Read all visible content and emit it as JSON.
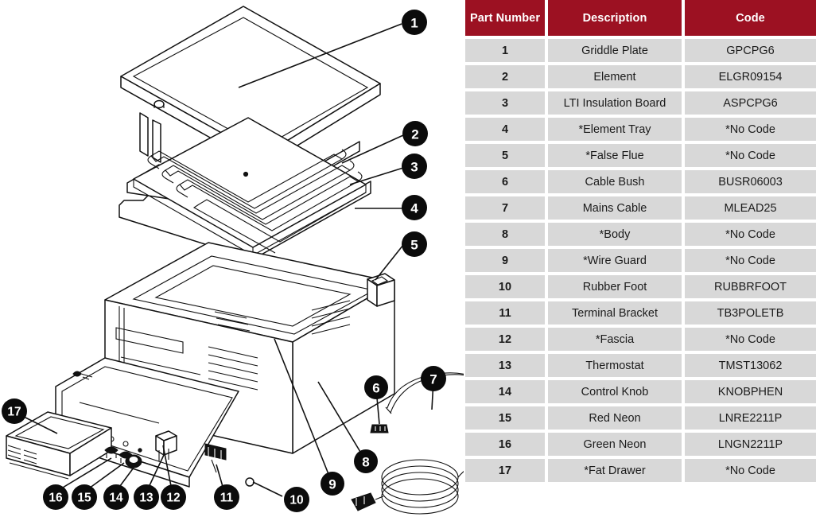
{
  "table": {
    "headers": [
      "Part Number",
      "Description",
      "Code"
    ],
    "header_bg": "#9c1122",
    "row_bg": "#d8d8d8",
    "rows": [
      {
        "number": "1",
        "description": "Griddle Plate",
        "code": "GPCPG6"
      },
      {
        "number": "2",
        "description": "Element",
        "code": "ELGR09154"
      },
      {
        "number": "3",
        "description": "LTI Insulation Board",
        "code": "ASPCPG6"
      },
      {
        "number": "4",
        "description": "*Element Tray",
        "code": "*No Code"
      },
      {
        "number": "5",
        "description": "*False Flue",
        "code": "*No Code"
      },
      {
        "number": "6",
        "description": "Cable Bush",
        "code": "BUSR06003"
      },
      {
        "number": "7",
        "description": "Mains Cable",
        "code": "MLEAD25"
      },
      {
        "number": "8",
        "description": "*Body",
        "code": "*No Code"
      },
      {
        "number": "9",
        "description": "*Wire Guard",
        "code": "*No Code"
      },
      {
        "number": "10",
        "description": "Rubber Foot",
        "code": "RUBBRFOOT"
      },
      {
        "number": "11",
        "description": "Terminal Bracket",
        "code": "TB3POLETB"
      },
      {
        "number": "12",
        "description": "*Fascia",
        "code": "*No Code"
      },
      {
        "number": "13",
        "description": "Thermostat",
        "code": "TMST13062"
      },
      {
        "number": "14",
        "description": "Control Knob",
        "code": "KNOBPHEN"
      },
      {
        "number": "15",
        "description": "Red Neon",
        "code": "LNRE2211P"
      },
      {
        "number": "16",
        "description": "Green Neon",
        "code": "LNGN2211P"
      },
      {
        "number": "17",
        "description": "*Fat Drawer",
        "code": "*No Code"
      }
    ]
  },
  "diagram": {
    "callouts": [
      {
        "id": "1",
        "label": "1",
        "part": "griddle-plate"
      },
      {
        "id": "2",
        "label": "2",
        "part": "element"
      },
      {
        "id": "3",
        "label": "3",
        "part": "lti-insulation-board"
      },
      {
        "id": "4",
        "label": "4",
        "part": "element-tray"
      },
      {
        "id": "5",
        "label": "5",
        "part": "false-flue"
      },
      {
        "id": "6",
        "label": "6",
        "part": "cable-bush"
      },
      {
        "id": "7",
        "label": "7",
        "part": "mains-cable"
      },
      {
        "id": "8",
        "label": "8",
        "part": "body"
      },
      {
        "id": "9",
        "label": "9",
        "part": "wire-guard"
      },
      {
        "id": "10",
        "label": "10",
        "part": "rubber-foot"
      },
      {
        "id": "11",
        "label": "11",
        "part": "terminal-bracket"
      },
      {
        "id": "12",
        "label": "12",
        "part": "fascia"
      },
      {
        "id": "13",
        "label": "13",
        "part": "thermostat"
      },
      {
        "id": "14",
        "label": "14",
        "part": "control-knob"
      },
      {
        "id": "15",
        "label": "15",
        "part": "red-neon"
      },
      {
        "id": "16",
        "label": "16",
        "part": "green-neon"
      },
      {
        "id": "17",
        "label": "17",
        "part": "fat-drawer"
      }
    ]
  }
}
